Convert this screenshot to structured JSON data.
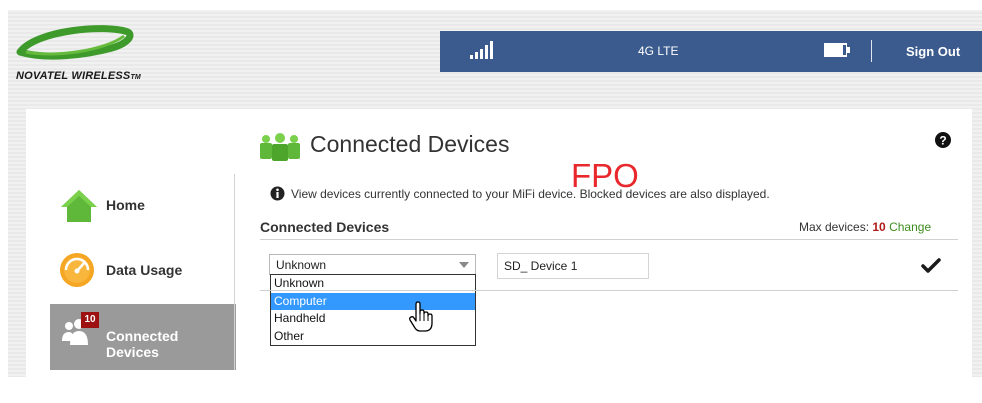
{
  "brand": {
    "logo_text": "NOVATEL WIRELESS",
    "logo_tm": "TM"
  },
  "colors": {
    "topbar": "#3b5b8e",
    "accent_green": "#3e8e21",
    "badge": "#9e1111",
    "selected_option": "#3399ff",
    "fpo": "#e8282c"
  },
  "header": {
    "signal_icon": "signal-bars-icon",
    "network": "4G LTE",
    "battery_icon": "battery-icon",
    "signout_label": "Sign Out"
  },
  "sidebar": {
    "items": [
      {
        "label": "Home",
        "icon": "home-icon"
      },
      {
        "label": "Data Usage",
        "icon": "gauge-icon"
      },
      {
        "label": "Connected Devices",
        "icon": "devices-icon",
        "badge": "10",
        "active": true
      }
    ]
  },
  "main": {
    "title": "Connected Devices",
    "help_icon": "help-icon",
    "fpo_mark": "FPO",
    "info_text": "View devices currently connected to your MiFi device. Blocked devices are also displayed.",
    "section_title": "Connected Devices",
    "max_devices_label": "Max devices:",
    "max_devices_value": "10",
    "change_label": "Change"
  },
  "device_row": {
    "type_select_value": "Unknown",
    "type_options": [
      "Unknown",
      "Computer",
      "Handheld",
      "Other"
    ],
    "highlighted_option": "Computer",
    "name_value": "SD_ Device 1",
    "confirm_icon": "checkmark-icon"
  }
}
